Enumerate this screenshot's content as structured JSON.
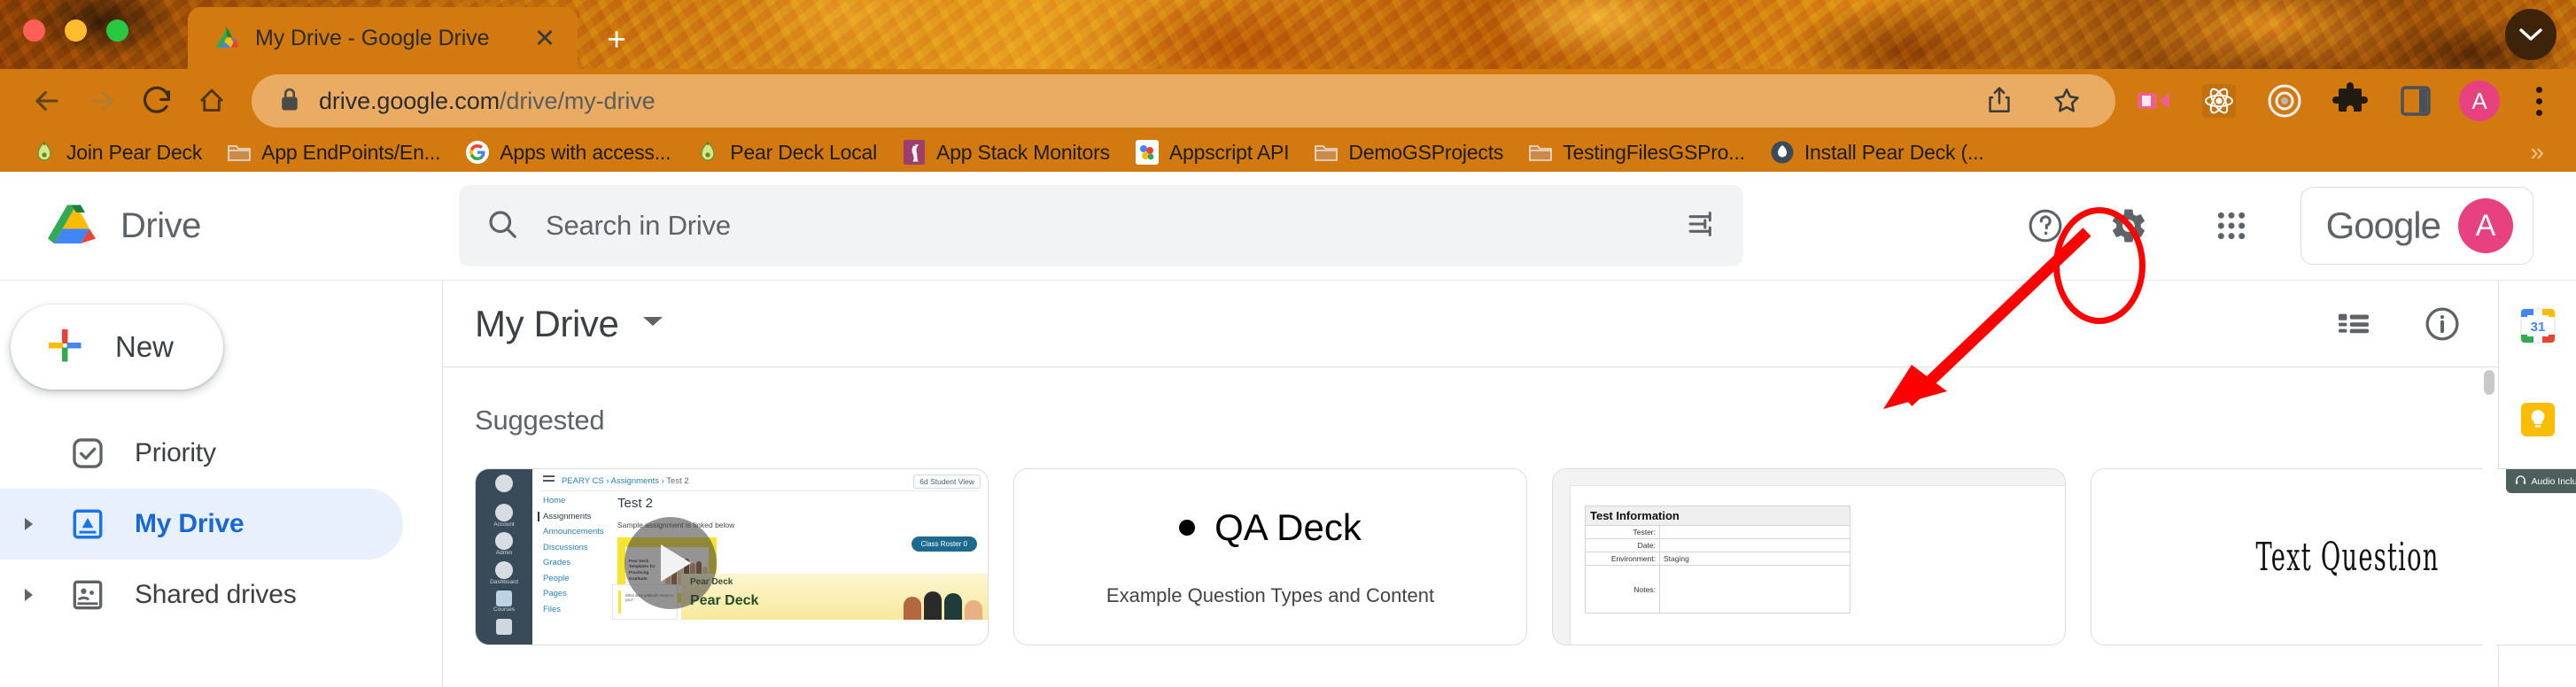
{
  "browser": {
    "tab": {
      "title": "My Drive - Google Drive",
      "favicon": "google-drive-icon",
      "close": "✕"
    },
    "new_tab_label": "+",
    "collapse_label": "chevron-down-icon",
    "url": {
      "prefix": "drive.google.com",
      "suffix": "/drive/my-drive",
      "lock": "lock-icon"
    },
    "nav": {
      "back": "back-arrow-icon",
      "forward": "forward-arrow-icon",
      "reload": "reload-icon",
      "home": "home-icon"
    },
    "omni_actions": {
      "share": "share-icon",
      "bookmark": "star-icon"
    },
    "toolbar_icons": [
      "screen-recorder-icon",
      "react-devtools-icon",
      "target-icon",
      "extensions-puzzle-icon",
      "side-panel-icon"
    ],
    "profile_initial": "A",
    "menu": "kebab-menu-icon",
    "bookmarks": [
      {
        "label": "Join Pear Deck",
        "icon": "pear-deck-icon"
      },
      {
        "label": "App EndPoints/En...",
        "icon": "folder-icon"
      },
      {
        "label": "Apps with access...",
        "icon": "google-g-icon"
      },
      {
        "label": "Pear Deck Local",
        "icon": "pear-deck-icon"
      },
      {
        "label": "App Stack Monitors",
        "icon": "stork-icon"
      },
      {
        "label": "Appscript API",
        "icon": "appscript-icon"
      },
      {
        "label": "DemoGSProjects",
        "icon": "folder-icon"
      },
      {
        "label": "TestingFilesGSPro...",
        "icon": "folder-icon"
      },
      {
        "label": "Install Pear Deck (...",
        "icon": "pear-deck-circle-icon"
      }
    ],
    "bookmarks_overflow": "»"
  },
  "drive": {
    "brand": "Drive",
    "brand_icon": "google-drive-logo",
    "search": {
      "placeholder": "Search in Drive",
      "value": "",
      "icon": "search-icon",
      "filter_icon": "tune-filter-icon"
    },
    "header_actions": {
      "help": "help-circle-icon",
      "settings": "gear-icon",
      "apps": "apps-grid-icon"
    },
    "account": {
      "wordmark": "Google",
      "initial": "A"
    },
    "new_button": {
      "label": "New",
      "icon": "plus-icon"
    },
    "sidebar": [
      {
        "label": "Priority",
        "icon": "priority-check-icon",
        "expandable": false,
        "active": false
      },
      {
        "label": "My Drive",
        "icon": "my-drive-icon",
        "expandable": true,
        "active": true
      },
      {
        "label": "Shared drives",
        "icon": "shared-drives-icon",
        "expandable": true,
        "active": false
      }
    ],
    "main": {
      "title": "My Drive",
      "title_caret": "chevron-down-icon",
      "view_toggle_icon": "list-view-icon",
      "details_icon": "info-circle-icon",
      "section_label": "Suggested"
    },
    "cards": [
      {
        "type": "video-thumbnail",
        "name": "canvas-test-2-video",
        "lms": {
          "breadcrumbs": [
            "PEARY CS",
            "Assignments",
            "Test 2"
          ],
          "student_view": "6d Student View",
          "heading": "Test 2",
          "subtext": "Sample assignment is linked below",
          "nav": [
            "Home",
            "Assignments",
            "Announcements",
            "Discussions",
            "Grades",
            "People",
            "Pages",
            "Files"
          ],
          "active_nav": "Assignments",
          "rail": [
            "Account",
            "Admin",
            "Dashboard",
            "Courses"
          ],
          "roster_button": "Class Roster 0",
          "slide_text": [
            "Pear Deck",
            "Templates for",
            "Practicing",
            "Gratitude"
          ],
          "brand_small": "Pear Deck",
          "brand_large": "Pear Deck",
          "left_card_text": "What does gratitude mean to you?"
        },
        "play_icon": "play-triangle-icon"
      },
      {
        "type": "slide",
        "name": "qa-deck-slide",
        "title": "QA Deck",
        "bullet": "•",
        "subtitle": "Example Question Types and Content"
      },
      {
        "type": "spreadsheet",
        "name": "test-information-sheet",
        "header": "Test Information",
        "rows": [
          {
            "label": "Tester:",
            "value": ""
          },
          {
            "label": "Date:",
            "value": ""
          },
          {
            "label": "Environment:",
            "value": "Staging"
          },
          {
            "label": "Notes:",
            "value": ""
          }
        ]
      },
      {
        "type": "slide",
        "name": "text-question-slide",
        "title": "Text Question",
        "badge": "Audio Included",
        "badge_icon": "headphones-icon"
      }
    ],
    "right_rail": [
      {
        "name": "google-calendar-icon",
        "label": "31"
      },
      {
        "name": "google-keep-icon",
        "label": ""
      },
      {
        "name": "google-tasks-icon",
        "label": ""
      }
    ]
  },
  "annotations": {
    "highlight_target": "gear-icon",
    "ring_color": "#ff0000",
    "arrow_color": "#ff0000"
  }
}
